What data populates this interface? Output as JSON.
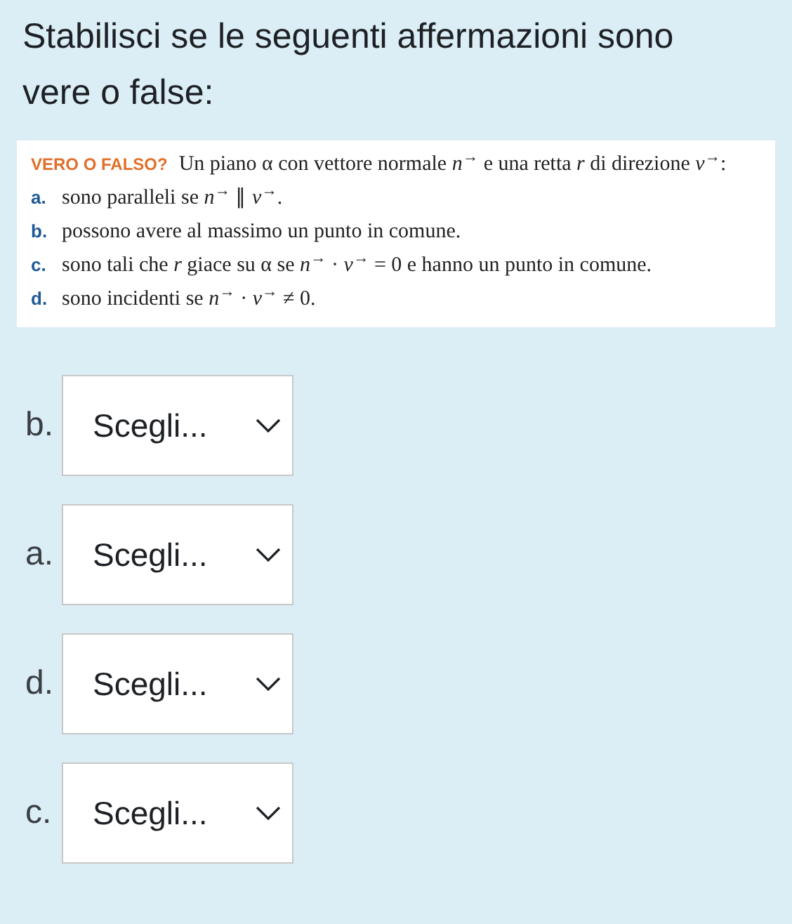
{
  "question": "Stabilisci se le seguenti affermazioni sono vere o false:",
  "statement": {
    "tag": "VERO O FALSO?",
    "intro": "Un piano α con vettore normale *n*$^{→}$ e una retta *r* di direzione *v*$^{→}$:",
    "items": [
      {
        "letter": "a.",
        "text": "sono paralleli se *n*$^{→}$ ∥ *v*$^{→}$."
      },
      {
        "letter": "b.",
        "text": "possono avere al massimo un punto in comune."
      },
      {
        "letter": "c.",
        "text": "sono tali che *r* giace su α se *n*$^{→}$ · *v*$^{→}$ = 0 e hanno un punto in comune."
      },
      {
        "letter": "d.",
        "text": "sono incidenti se *n*$^{→}$ · *v*$^{→}$ ≠ 0."
      }
    ]
  },
  "answers": [
    {
      "label": "b.",
      "value": "Scegli..."
    },
    {
      "label": "a.",
      "value": "Scegli..."
    },
    {
      "label": "d.",
      "value": "Scegli..."
    },
    {
      "label": "c.",
      "value": "Scegli..."
    }
  ]
}
